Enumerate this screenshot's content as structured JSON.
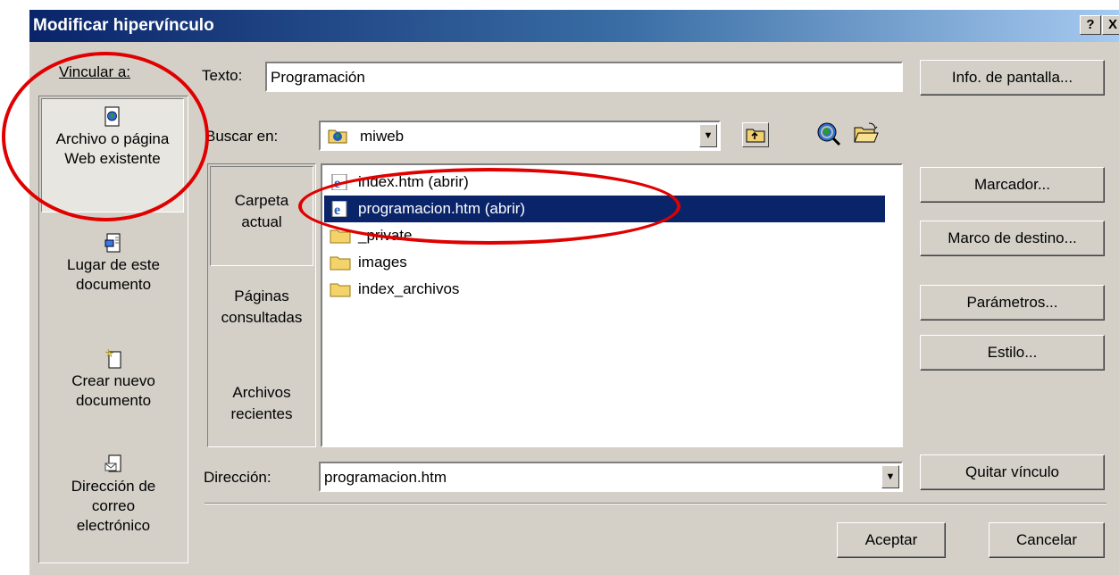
{
  "window": {
    "title": "Modificar hipervínculo",
    "help_btn": "?",
    "close_btn": "X"
  },
  "link_to_label": "Vincular a:",
  "nav_items": [
    {
      "label": "Archivo o página Web existente",
      "icon": "web-page-icon",
      "selected": true
    },
    {
      "label": "Lugar de este documento",
      "icon": "document-place-icon"
    },
    {
      "label": "Crear nuevo documento",
      "icon": "new-document-icon"
    },
    {
      "label": "Dirección de correo electrónico",
      "icon": "email-icon"
    }
  ],
  "text_field": {
    "label": "Texto:",
    "value": "Programación"
  },
  "screen_tip_button": "Info. de pantalla...",
  "search_in": {
    "label": "Buscar en:",
    "value": "miweb",
    "icon": "web-folder-icon"
  },
  "toolbar_icons": [
    "up-folder-icon",
    "browse-web-icon",
    "browse-file-icon"
  ],
  "sub_nav": [
    {
      "label": "Carpeta actual",
      "selected": true
    },
    {
      "label": "Páginas consultadas"
    },
    {
      "label": "Archivos recientes"
    }
  ],
  "files": [
    {
      "name": "index.htm (abrir)",
      "icon": "ie-page-icon"
    },
    {
      "name": "programacion.htm (abrir)",
      "icon": "ie-page-icon",
      "selected": true
    },
    {
      "name": "_private",
      "icon": "folder-icon"
    },
    {
      "name": "images",
      "icon": "folder-icon"
    },
    {
      "name": "index_archivos",
      "icon": "folder-icon"
    }
  ],
  "right_buttons": [
    "Marcador...",
    "Marco de destino...",
    "Parámetros...",
    "Estilo..."
  ],
  "address": {
    "label": "Dirección:",
    "value": "programacion.htm"
  },
  "remove_link_button": "Quitar vínculo",
  "ok_button": "Aceptar",
  "cancel_button": "Cancelar",
  "colors": {
    "highlight": "#0a246a",
    "annotation": "#e00000",
    "face": "#d4d0c8"
  }
}
